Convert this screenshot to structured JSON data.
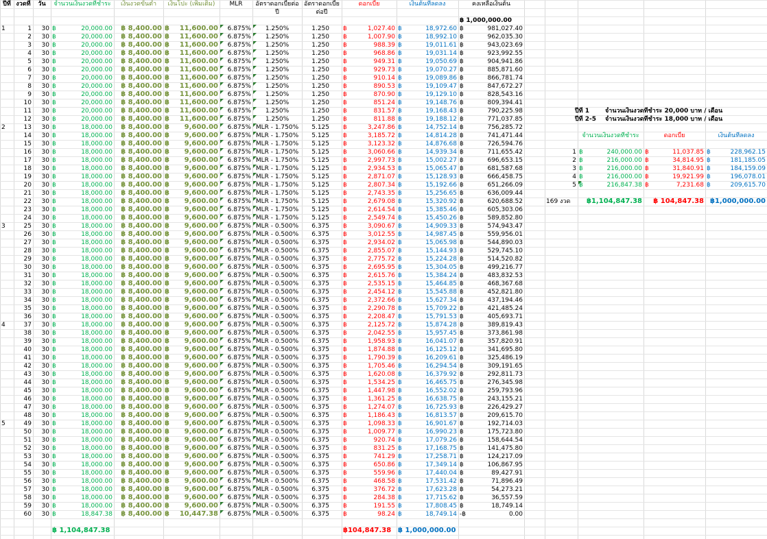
{
  "headers": {
    "year": "ปีที่",
    "period": "งวดที่",
    "days": "วัน",
    "payment": "จำนวนเงินงวดที่ชำระ",
    "min_payment": "เงินงวดขั้นต่ำ",
    "extra": "เงินโปะ (เพิ่มเติม)",
    "mlr": "MLR",
    "rate": "อัตราดอกเบี้ยต่อปี",
    "rate2": "อัตราดอกเบี้ยต่อปี",
    "interest": "ดอกเบี้ย",
    "principal": "เงินต้นที่ลดลง",
    "balance": "คงเหลือเงินต้น"
  },
  "currency": "฿",
  "initial_balance": "฿ 1,000,000.00",
  "mlr_value": "6.875%",
  "rows": [
    {
      "y": "1",
      "n": "1",
      "d": "30",
      "pay": "20,000.00",
      "min": "฿ 8,400.00",
      "ext": "11,600.00",
      "rate": "1.250%",
      "r2": "1.250",
      "int": "1,027.40",
      "prin": "18,972.60",
      "bal": "981,027.40"
    },
    {
      "y": "",
      "n": "2",
      "d": "30",
      "pay": "20,000.00",
      "min": "฿ 8,400.00",
      "ext": "11,600.00",
      "rate": "1.250%",
      "r2": "1.250",
      "int": "1,007.90",
      "prin": "18,992.10",
      "bal": "962,035.30"
    },
    {
      "y": "",
      "n": "3",
      "d": "30",
      "pay": "20,000.00",
      "min": "฿ 8,400.00",
      "ext": "11,600.00",
      "rate": "1.250%",
      "r2": "1.250",
      "int": "988.39",
      "prin": "19,011.61",
      "bal": "943,023.69"
    },
    {
      "y": "",
      "n": "4",
      "d": "30",
      "pay": "20,000.00",
      "min": "฿ 8,400.00",
      "ext": "11,600.00",
      "rate": "1.250%",
      "r2": "1.250",
      "int": "968.86",
      "prin": "19,031.14",
      "bal": "923,992.55"
    },
    {
      "y": "",
      "n": "5",
      "d": "30",
      "pay": "20,000.00",
      "min": "฿ 8,400.00",
      "ext": "11,600.00",
      "rate": "1.250%",
      "r2": "1.250",
      "int": "949.31",
      "prin": "19,050.69",
      "bal": "904,941.86"
    },
    {
      "y": "",
      "n": "6",
      "d": "30",
      "pay": "20,000.00",
      "min": "฿ 8,400.00",
      "ext": "11,600.00",
      "rate": "1.250%",
      "r2": "1.250",
      "int": "929.73",
      "prin": "19,070.27",
      "bal": "885,871.60"
    },
    {
      "y": "",
      "n": "7",
      "d": "30",
      "pay": "20,000.00",
      "min": "฿ 8,400.00",
      "ext": "11,600.00",
      "rate": "1.250%",
      "r2": "1.250",
      "int": "910.14",
      "prin": "19,089.86",
      "bal": "866,781.74"
    },
    {
      "y": "",
      "n": "8",
      "d": "30",
      "pay": "20,000.00",
      "min": "฿ 8,400.00",
      "ext": "11,600.00",
      "rate": "1.250%",
      "r2": "1.250",
      "int": "890.53",
      "prin": "19,109.47",
      "bal": "847,672.27"
    },
    {
      "y": "",
      "n": "9",
      "d": "30",
      "pay": "20,000.00",
      "min": "฿ 8,400.00",
      "ext": "11,600.00",
      "rate": "1.250%",
      "r2": "1.250",
      "int": "870.90",
      "prin": "19,129.10",
      "bal": "828,543.16"
    },
    {
      "y": "",
      "n": "10",
      "d": "30",
      "pay": "20,000.00",
      "min": "฿ 8,400.00",
      "ext": "11,600.00",
      "rate": "1.250%",
      "r2": "1.250",
      "int": "851.24",
      "prin": "19,148.76",
      "bal": "809,394.41"
    },
    {
      "y": "",
      "n": "11",
      "d": "30",
      "pay": "20,000.00",
      "min": "฿ 8,400.00",
      "ext": "11,600.00",
      "rate": "1.250%",
      "r2": "1.250",
      "int": "831.57",
      "prin": "19,168.43",
      "bal": "790,225.98"
    },
    {
      "y": "",
      "n": "12",
      "d": "30",
      "pay": "20,000.00",
      "min": "฿ 8,400.00",
      "ext": "11,600.00",
      "rate": "1.250%",
      "r2": "1.250",
      "int": "811.88",
      "prin": "19,188.12",
      "bal": "771,037.85"
    },
    {
      "y": "2",
      "n": "13",
      "d": "30",
      "pay": "18,000.00",
      "min": "฿ 8,400.00",
      "ext": "9,600.00",
      "rate": "MLR - 1.750%",
      "r2": "5.125",
      "int": "3,247.86",
      "prin": "14,752.14",
      "bal": "756,285.72"
    },
    {
      "y": "",
      "n": "14",
      "d": "30",
      "pay": "18,000.00",
      "min": "฿ 8,400.00",
      "ext": "9,600.00",
      "rate": "MLR - 1.750%",
      "r2": "5.125",
      "int": "3,185.72",
      "prin": "14,814.28",
      "bal": "741,471.44"
    },
    {
      "y": "",
      "n": "15",
      "d": "30",
      "pay": "18,000.00",
      "min": "฿ 8,400.00",
      "ext": "9,600.00",
      "rate": "MLR - 1.750%",
      "r2": "5.125",
      "int": "3,123.32",
      "prin": "14,876.68",
      "bal": "726,594.76"
    },
    {
      "y": "",
      "n": "16",
      "d": "30",
      "pay": "18,000.00",
      "min": "฿ 8,400.00",
      "ext": "9,600.00",
      "rate": "MLR - 1.750%",
      "r2": "5.125",
      "int": "3,060.66",
      "prin": "14,939.34",
      "bal": "711,655.42"
    },
    {
      "y": "",
      "n": "17",
      "d": "30",
      "pay": "18,000.00",
      "min": "฿ 8,400.00",
      "ext": "9,600.00",
      "rate": "MLR - 1.750%",
      "r2": "5.125",
      "int": "2,997.73",
      "prin": "15,002.27",
      "bal": "696,653.15"
    },
    {
      "y": "",
      "n": "18",
      "d": "30",
      "pay": "18,000.00",
      "min": "฿ 8,400.00",
      "ext": "9,600.00",
      "rate": "MLR - 1.750%",
      "r2": "5.125",
      "int": "2,934.53",
      "prin": "15,065.47",
      "bal": "681,587.68"
    },
    {
      "y": "",
      "n": "19",
      "d": "30",
      "pay": "18,000.00",
      "min": "฿ 8,400.00",
      "ext": "9,600.00",
      "rate": "MLR - 1.750%",
      "r2": "5.125",
      "int": "2,871.07",
      "prin": "15,128.93",
      "bal": "666,458.75"
    },
    {
      "y": "",
      "n": "20",
      "d": "30",
      "pay": "18,000.00",
      "min": "฿ 8,400.00",
      "ext": "9,600.00",
      "rate": "MLR - 1.750%",
      "r2": "5.125",
      "int": "2,807.34",
      "prin": "15,192.66",
      "bal": "651,266.09"
    },
    {
      "y": "",
      "n": "21",
      "d": "30",
      "pay": "18,000.00",
      "min": "฿ 8,400.00",
      "ext": "9,600.00",
      "rate": "MLR - 1.750%",
      "r2": "5.125",
      "int": "2,743.35",
      "prin": "15,256.65",
      "bal": "636,009.44"
    },
    {
      "y": "",
      "n": "22",
      "d": "30",
      "pay": "18,000.00",
      "min": "฿ 8,400.00",
      "ext": "9,600.00",
      "rate": "MLR - 1.750%",
      "r2": "5.125",
      "int": "2,679.08",
      "prin": "15,320.92",
      "bal": "620,688.52"
    },
    {
      "y": "",
      "n": "23",
      "d": "30",
      "pay": "18,000.00",
      "min": "฿ 8,400.00",
      "ext": "9,600.00",
      "rate": "MLR - 1.750%",
      "r2": "5.125",
      "int": "2,614.54",
      "prin": "15,385.46",
      "bal": "605,303.06"
    },
    {
      "y": "",
      "n": "24",
      "d": "30",
      "pay": "18,000.00",
      "min": "฿ 8,400.00",
      "ext": "9,600.00",
      "rate": "MLR - 1.750%",
      "r2": "5.125",
      "int": "2,549.74",
      "prin": "15,450.26",
      "bal": "589,852.80"
    },
    {
      "y": "3",
      "n": "25",
      "d": "30",
      "pay": "18,000.00",
      "min": "฿ 8,400.00",
      "ext": "9,600.00",
      "rate": "MLR - 0.500%",
      "r2": "6.375",
      "int": "3,090.67",
      "prin": "14,909.33",
      "bal": "574,943.47"
    },
    {
      "y": "",
      "n": "26",
      "d": "30",
      "pay": "18,000.00",
      "min": "฿ 8,400.00",
      "ext": "9,600.00",
      "rate": "MLR - 0.500%",
      "r2": "6.375",
      "int": "3,012.55",
      "prin": "14,987.45",
      "bal": "559,956.01"
    },
    {
      "y": "",
      "n": "27",
      "d": "30",
      "pay": "18,000.00",
      "min": "฿ 8,400.00",
      "ext": "9,600.00",
      "rate": "MLR - 0.500%",
      "r2": "6.375",
      "int": "2,934.02",
      "prin": "15,065.98",
      "bal": "544,890.03"
    },
    {
      "y": "",
      "n": "28",
      "d": "30",
      "pay": "18,000.00",
      "min": "฿ 8,400.00",
      "ext": "9,600.00",
      "rate": "MLR - 0.500%",
      "r2": "6.375",
      "int": "2,855.07",
      "prin": "15,144.93",
      "bal": "529,745.10"
    },
    {
      "y": "",
      "n": "29",
      "d": "30",
      "pay": "18,000.00",
      "min": "฿ 8,400.00",
      "ext": "9,600.00",
      "rate": "MLR - 0.500%",
      "r2": "6.375",
      "int": "2,775.72",
      "prin": "15,224.28",
      "bal": "514,520.82"
    },
    {
      "y": "",
      "n": "30",
      "d": "30",
      "pay": "18,000.00",
      "min": "฿ 8,400.00",
      "ext": "9,600.00",
      "rate": "MLR - 0.500%",
      "r2": "6.375",
      "int": "2,695.95",
      "prin": "15,304.05",
      "bal": "499,216.77"
    },
    {
      "y": "",
      "n": "31",
      "d": "30",
      "pay": "18,000.00",
      "min": "฿ 8,400.00",
      "ext": "9,600.00",
      "rate": "MLR - 0.500%",
      "r2": "6.375",
      "int": "2,615.76",
      "prin": "15,384.24",
      "bal": "483,832.53"
    },
    {
      "y": "",
      "n": "32",
      "d": "30",
      "pay": "18,000.00",
      "min": "฿ 8,400.00",
      "ext": "9,600.00",
      "rate": "MLR - 0.500%",
      "r2": "6.375",
      "int": "2,535.15",
      "prin": "15,464.85",
      "bal": "468,367.68"
    },
    {
      "y": "",
      "n": "33",
      "d": "30",
      "pay": "18,000.00",
      "min": "฿ 8,400.00",
      "ext": "9,600.00",
      "rate": "MLR - 0.500%",
      "r2": "6.375",
      "int": "2,454.12",
      "prin": "15,545.88",
      "bal": "452,821.80"
    },
    {
      "y": "",
      "n": "34",
      "d": "30",
      "pay": "18,000.00",
      "min": "฿ 8,400.00",
      "ext": "9,600.00",
      "rate": "MLR - 0.500%",
      "r2": "6.375",
      "int": "2,372.66",
      "prin": "15,627.34",
      "bal": "437,194.46"
    },
    {
      "y": "",
      "n": "35",
      "d": "30",
      "pay": "18,000.00",
      "min": "฿ 8,400.00",
      "ext": "9,600.00",
      "rate": "MLR - 0.500%",
      "r2": "6.375",
      "int": "2,290.78",
      "prin": "15,709.22",
      "bal": "421,485.24"
    },
    {
      "y": "",
      "n": "36",
      "d": "30",
      "pay": "18,000.00",
      "min": "฿ 8,400.00",
      "ext": "9,600.00",
      "rate": "MLR - 0.500%",
      "r2": "6.375",
      "int": "2,208.47",
      "prin": "15,791.53",
      "bal": "405,693.71"
    },
    {
      "y": "4",
      "n": "37",
      "d": "30",
      "pay": "18,000.00",
      "min": "฿ 8,400.00",
      "ext": "9,600.00",
      "rate": "MLR - 0.500%",
      "r2": "6.375",
      "int": "2,125.72",
      "prin": "15,874.28",
      "bal": "389,819.43"
    },
    {
      "y": "",
      "n": "38",
      "d": "30",
      "pay": "18,000.00",
      "min": "฿ 8,400.00",
      "ext": "9,600.00",
      "rate": "MLR - 0.500%",
      "r2": "6.375",
      "int": "2,042.55",
      "prin": "15,957.45",
      "bal": "373,861.98"
    },
    {
      "y": "",
      "n": "39",
      "d": "30",
      "pay": "18,000.00",
      "min": "฿ 8,400.00",
      "ext": "9,600.00",
      "rate": "MLR - 0.500%",
      "r2": "6.375",
      "int": "1,958.93",
      "prin": "16,041.07",
      "bal": "357,820.91"
    },
    {
      "y": "",
      "n": "40",
      "d": "30",
      "pay": "18,000.00",
      "min": "฿ 8,400.00",
      "ext": "9,600.00",
      "rate": "MLR - 0.500%",
      "r2": "6.375",
      "int": "1,874.88",
      "prin": "16,125.12",
      "bal": "341,695.80"
    },
    {
      "y": "",
      "n": "41",
      "d": "30",
      "pay": "18,000.00",
      "min": "฿ 8,400.00",
      "ext": "9,600.00",
      "rate": "MLR - 0.500%",
      "r2": "6.375",
      "int": "1,790.39",
      "prin": "16,209.61",
      "bal": "325,486.19"
    },
    {
      "y": "",
      "n": "42",
      "d": "30",
      "pay": "18,000.00",
      "min": "฿ 8,400.00",
      "ext": "9,600.00",
      "rate": "MLR - 0.500%",
      "r2": "6.375",
      "int": "1,705.46",
      "prin": "16,294.54",
      "bal": "309,191.65"
    },
    {
      "y": "",
      "n": "43",
      "d": "30",
      "pay": "18,000.00",
      "min": "฿ 8,400.00",
      "ext": "9,600.00",
      "rate": "MLR - 0.500%",
      "r2": "6.375",
      "int": "1,620.08",
      "prin": "16,379.92",
      "bal": "292,811.73"
    },
    {
      "y": "",
      "n": "44",
      "d": "30",
      "pay": "18,000.00",
      "min": "฿ 8,400.00",
      "ext": "9,600.00",
      "rate": "MLR - 0.500%",
      "r2": "6.375",
      "int": "1,534.25",
      "prin": "16,465.75",
      "bal": "276,345.98"
    },
    {
      "y": "",
      "n": "45",
      "d": "30",
      "pay": "18,000.00",
      "min": "฿ 8,400.00",
      "ext": "9,600.00",
      "rate": "MLR - 0.500%",
      "r2": "6.375",
      "int": "1,447.98",
      "prin": "16,552.02",
      "bal": "259,793.96"
    },
    {
      "y": "",
      "n": "46",
      "d": "30",
      "pay": "18,000.00",
      "min": "฿ 8,400.00",
      "ext": "9,600.00",
      "rate": "MLR - 0.500%",
      "r2": "6.375",
      "int": "1,361.25",
      "prin": "16,638.75",
      "bal": "243,155.21"
    },
    {
      "y": "",
      "n": "47",
      "d": "30",
      "pay": "18,000.00",
      "min": "฿ 8,400.00",
      "ext": "9,600.00",
      "rate": "MLR - 0.500%",
      "r2": "6.375",
      "int": "1,274.07",
      "prin": "16,725.93",
      "bal": "226,429.27"
    },
    {
      "y": "",
      "n": "48",
      "d": "30",
      "pay": "18,000.00",
      "min": "฿ 8,400.00",
      "ext": "9,600.00",
      "rate": "MLR - 0.500%",
      "r2": "6.375",
      "int": "1,186.43",
      "prin": "16,813.57",
      "bal": "209,615.70"
    },
    {
      "y": "5",
      "n": "49",
      "d": "30",
      "pay": "18,000.00",
      "min": "฿ 8,400.00",
      "ext": "9,600.00",
      "rate": "MLR - 0.500%",
      "r2": "6.375",
      "int": "1,098.33",
      "prin": "16,901.67",
      "bal": "192,714.03"
    },
    {
      "y": "",
      "n": "50",
      "d": "30",
      "pay": "18,000.00",
      "min": "฿ 8,400.00",
      "ext": "9,600.00",
      "rate": "MLR - 0.500%",
      "r2": "6.375",
      "int": "1,009.77",
      "prin": "16,990.23",
      "bal": "175,723.80"
    },
    {
      "y": "",
      "n": "51",
      "d": "30",
      "pay": "18,000.00",
      "min": "฿ 8,400.00",
      "ext": "9,600.00",
      "rate": "MLR - 0.500%",
      "r2": "6.375",
      "int": "920.74",
      "prin": "17,079.26",
      "bal": "158,644.54"
    },
    {
      "y": "",
      "n": "52",
      "d": "30",
      "pay": "18,000.00",
      "min": "฿ 8,400.00",
      "ext": "9,600.00",
      "rate": "MLR - 0.500%",
      "r2": "6.375",
      "int": "831.25",
      "prin": "17,168.75",
      "bal": "141,475.80"
    },
    {
      "y": "",
      "n": "53",
      "d": "30",
      "pay": "18,000.00",
      "min": "฿ 8,400.00",
      "ext": "9,600.00",
      "rate": "MLR - 0.500%",
      "r2": "6.375",
      "int": "741.29",
      "prin": "17,258.71",
      "bal": "124,217.09"
    },
    {
      "y": "",
      "n": "54",
      "d": "30",
      "pay": "18,000.00",
      "min": "฿ 8,400.00",
      "ext": "9,600.00",
      "rate": "MLR - 0.500%",
      "r2": "6.375",
      "int": "650.86",
      "prin": "17,349.14",
      "bal": "106,867.95"
    },
    {
      "y": "",
      "n": "55",
      "d": "30",
      "pay": "18,000.00",
      "min": "฿ 8,400.00",
      "ext": "9,600.00",
      "rate": "MLR - 0.500%",
      "r2": "6.375",
      "int": "559.96",
      "prin": "17,440.04",
      "bal": "89,427.91"
    },
    {
      "y": "",
      "n": "56",
      "d": "30",
      "pay": "18,000.00",
      "min": "฿ 8,400.00",
      "ext": "9,600.00",
      "rate": "MLR - 0.500%",
      "r2": "6.375",
      "int": "468.58",
      "prin": "17,531.42",
      "bal": "71,896.49"
    },
    {
      "y": "",
      "n": "57",
      "d": "30",
      "pay": "18,000.00",
      "min": "฿ 8,400.00",
      "ext": "9,600.00",
      "rate": "MLR - 0.500%",
      "r2": "6.375",
      "int": "376.72",
      "prin": "17,623.28",
      "bal": "54,273.21"
    },
    {
      "y": "",
      "n": "58",
      "d": "30",
      "pay": "18,000.00",
      "min": "฿ 8,400.00",
      "ext": "9,600.00",
      "rate": "MLR - 0.500%",
      "r2": "6.375",
      "int": "284.38",
      "prin": "17,715.62",
      "bal": "36,557.59"
    },
    {
      "y": "",
      "n": "59",
      "d": "30",
      "pay": "18,000.00",
      "min": "฿ 8,400.00",
      "ext": "9,600.00",
      "rate": "MLR - 0.500%",
      "r2": "6.375",
      "int": "191.55",
      "prin": "17,808.45",
      "bal": "18,749.14"
    },
    {
      "y": "",
      "n": "60",
      "d": "30",
      "pay": "18,847.38",
      "min": "฿ 8,400.00",
      "ext": "10,447.38",
      "rate": "MLR - 0.500%",
      "r2": "6.375",
      "int": "98.24",
      "prin": "18,749.14",
      "bal": "0.00",
      "balsym": "-฿"
    }
  ],
  "totals": {
    "payment": "฿ 1,104,847.38",
    "interest": "฿104,847.38",
    "principal": "฿ 1,000,000.00"
  },
  "summary": {
    "line1_label": "ปีที่ 1",
    "line1_text": "จำนวนเงินงวดที่ชำระ  20,000 บาท / เดือน",
    "line2_label": "ปีที่ 2-5",
    "line2_text": "จำนวนเงินงวดที่ชำระ  18,000 บาท / เดือน",
    "col_payment": "จำนวนเงินงวดที่ชำระ",
    "col_interest": "ดอกเบี้ย",
    "col_principal": "เงินต้นที่ลดลง",
    "rows": [
      {
        "year": "1",
        "pay": "240,000.00",
        "int": "11,037.85",
        "prin": "228,962.15"
      },
      {
        "year": "2",
        "pay": "216,000.00",
        "int": "34,814.95",
        "prin": "181,185.05"
      },
      {
        "year": "3",
        "pay": "216,000.00",
        "int": "31,840.91",
        "prin": "184,159.09"
      },
      {
        "year": "4",
        "pay": "216,000.00",
        "int": "19,921.99",
        "prin": "196,078.01"
      },
      {
        "year": "5",
        "pay": "216,847.38",
        "int": "7,231.68",
        "prin": "209,615.70"
      }
    ],
    "total_periods": "169 งวด",
    "total_pay": "฿1,104,847.38",
    "total_int": "฿ 104,847.38",
    "total_prin": "฿1,000,000.00"
  },
  "colors": {
    "payment": "#00b050",
    "min_extra": "#76933c",
    "interest": "#ff0000",
    "principal": "#0070c0",
    "grid": "#d9d9d9"
  }
}
